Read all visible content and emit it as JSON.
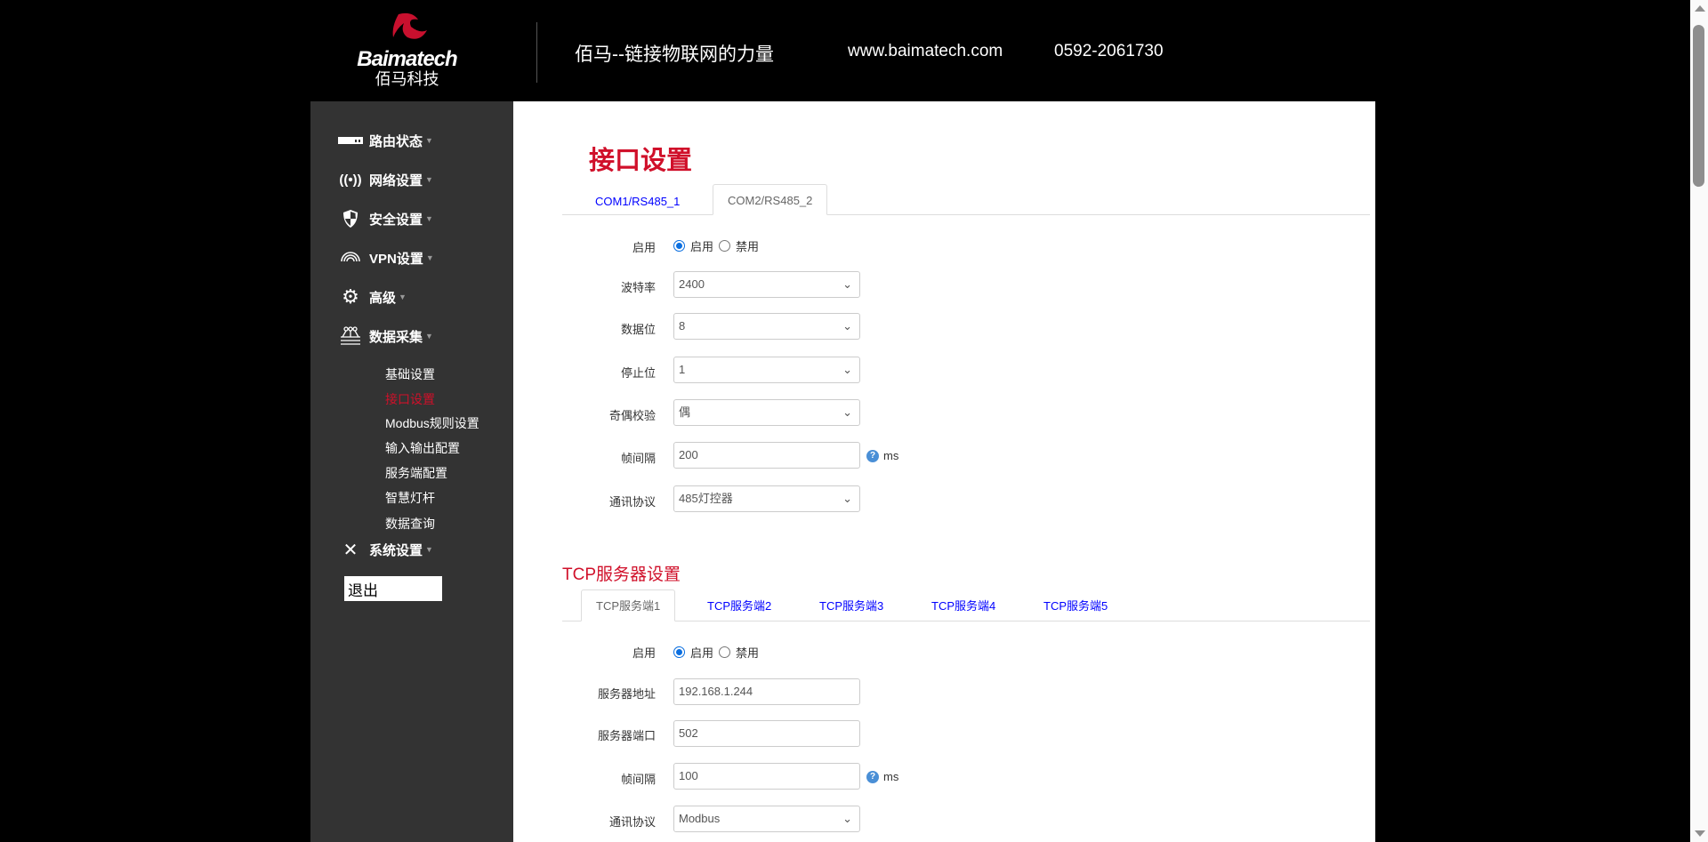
{
  "header": {
    "logo_en": "Baimatech",
    "logo_cn": "佰马科技",
    "tagline": "佰马--链接物联网的力量",
    "url": "www.baimatech.com",
    "phone": "0592-2061730"
  },
  "sidebar": {
    "items": [
      {
        "label": "路由状态",
        "icon": "router-icon"
      },
      {
        "label": "网络设置",
        "icon": "wireless-icon"
      },
      {
        "label": "安全设置",
        "icon": "shield-icon"
      },
      {
        "label": "VPN设置",
        "icon": "vpn-icon"
      },
      {
        "label": "高级",
        "icon": "gear-icon"
      },
      {
        "label": "数据采集",
        "icon": "data-collect-icon"
      },
      {
        "label": "系统设置",
        "icon": "tools-icon"
      }
    ],
    "submenu": [
      "基础设置",
      "接口设置",
      "Modbus规则设置",
      "输入输出配置",
      "服务端配置",
      "智慧灯杆",
      "数据查询"
    ],
    "active_sub": "接口设置",
    "logout": "退出"
  },
  "main": {
    "title": "接口设置",
    "tabs": [
      "COM1/RS485_1",
      "COM2/RS485_2"
    ],
    "active_tab": "COM2/RS485_2",
    "serial": {
      "enable_label": "启用",
      "opt_on": "启用",
      "opt_off": "禁用",
      "baud_label": "波特率",
      "baud": "2400",
      "databits_label": "数据位",
      "databits": "8",
      "stopbits_label": "停止位",
      "stopbits": "1",
      "parity_label": "奇偶校验",
      "parity": "偶",
      "interval_label": "帧间隔",
      "interval": "200",
      "unit": "ms",
      "protocol_label": "通讯协议",
      "protocol": "485灯控器"
    },
    "tcp_title": "TCP服务器设置",
    "tcp_tabs": [
      "TCP服务端1",
      "TCP服务端2",
      "TCP服务端3",
      "TCP服务端4",
      "TCP服务端5"
    ],
    "tcp": {
      "enable_label": "启用",
      "opt_on": "启用",
      "opt_off": "禁用",
      "addr_label": "服务器地址",
      "addr": "192.168.1.244",
      "port_label": "服务器端口",
      "port": "502",
      "interval_label": "帧间隔",
      "interval": "100",
      "unit": "ms",
      "protocol_label": "通讯协议",
      "protocol": "Modbus"
    }
  },
  "colors": {
    "accent": "#d0102a",
    "link": "#0000ff",
    "sidebar": "#333333"
  }
}
